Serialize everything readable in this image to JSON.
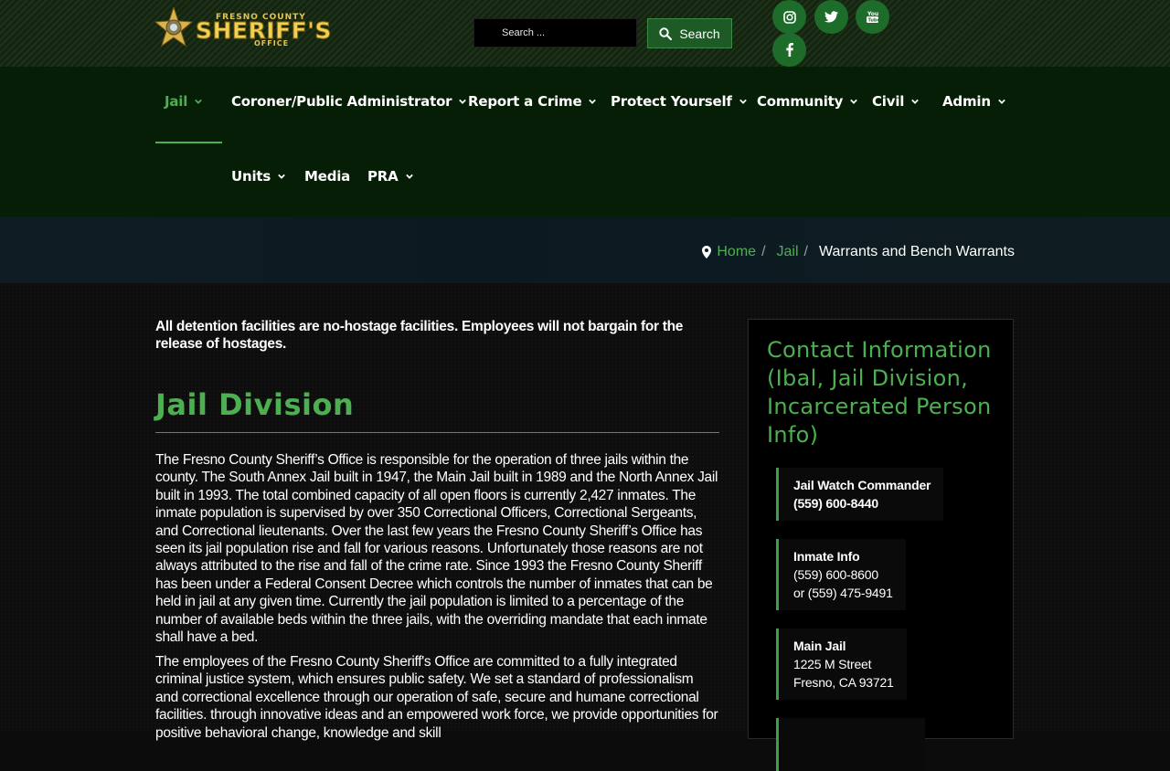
{
  "header": {
    "logo": {
      "top_text": "FRESNO COUNTY",
      "main_text": "SHERIFF'S",
      "bottom_text": "OFFICE"
    },
    "search": {
      "placeholder": "Search ...",
      "button_label": "Search"
    },
    "social_icons": [
      "instagram-icon",
      "twitter-icon",
      "youtube-icon",
      "facebook-icon"
    ]
  },
  "nav": {
    "items": [
      {
        "label": "Jail",
        "dropdown": true,
        "active": true
      },
      {
        "label": "Coroner/Public Administrator",
        "dropdown": true
      },
      {
        "label": "Report a Crime",
        "dropdown": true
      },
      {
        "label": "Protect Yourself",
        "dropdown": true
      },
      {
        "label": "Community",
        "dropdown": true
      },
      {
        "label": "Civil",
        "dropdown": true
      },
      {
        "label": "Admin",
        "dropdown": true
      },
      {
        "label": "Units",
        "dropdown": true
      },
      {
        "label": "Media",
        "dropdown": false
      },
      {
        "label": "PRA",
        "dropdown": true
      }
    ]
  },
  "breadcrumb": {
    "home": "Home",
    "sep": "/",
    "parent": "Jail",
    "current": "Warrants and Bench Warrants"
  },
  "main": {
    "notice": "All detention facilities are no-hostage facilities. Employees will not bargain for the release of hostages.",
    "title": "Jail Division",
    "paragraphs": [
      "The Fresno County Sheriff’s Office is responsible for the operation of three jails within the county. The South Annex Jail built in 1947, the Main Jail built in 1989 and the North Annex Jail built in 1993. The total combined capacity of all open floors is currently 2,427 inmates. The inmate population is supervised by over 350 Correctional Officers, Correctional Sergeants, and Correctional lieutenants. Over the last few years the Fresno County Sheriff’s Office has seen its jail population rise and fall for various reasons. Unfortunately those reasons are not always attributed to the rise and fall of the crime rate. Since 1993 the Fresno County Sheriff has been under a Federal Consent Decree which controls the number of inmates that can be held in jail at any given time. Currently the jail population is limited to a percentage of the number of available beds within the three jails, with the overriding mandate that each inmate shall have a bed.",
      "The employees of the Fresno County Sheriff's Office are committed to a fully integrated criminal justice system, which ensures public safety. We set a standard of professionalism and correctional excellence through our operation of safe, secure and humane correctional facilities. through innovative ideas and an empowered work force, we provide opportunities for positive behavioral change, knowledge and skill"
    ]
  },
  "sidebar": {
    "title": "Contact Information (Ibal, Jail Division, Incarcerated Person Info)",
    "cards": [
      {
        "label": "Jail Watch Commander",
        "line1": "(559) 600-8440",
        "line2": ""
      },
      {
        "label": "Inmate Info",
        "line1": "(559) 600-8600",
        "line2": "or (559) 475-9491"
      },
      {
        "label": "Main Jail",
        "line1": "1225 M Street",
        "line2": "Fresno, CA 93721"
      }
    ]
  },
  "colors": {
    "accent_green": "#4caf50",
    "header_bg": "#13250f",
    "nav_bg": "#061d06",
    "button_green": "#1d5a25"
  }
}
